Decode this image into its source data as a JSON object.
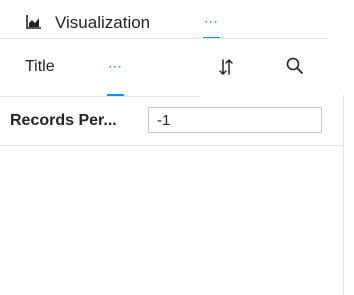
{
  "header": {
    "icon": "bar-chart-icon",
    "title": "Visualization",
    "more_label": "⋯"
  },
  "field_bar": {
    "title_label": "Title",
    "more_label": "⋯",
    "sort_icon": "sort-icon",
    "search_icon": "search-icon"
  },
  "records": {
    "label": "Records Per...",
    "value": "-1"
  },
  "colors": {
    "accent": "#118dff",
    "text": "#252423",
    "divider": "#e6e6e6",
    "input_border": "#c8c6c4"
  }
}
